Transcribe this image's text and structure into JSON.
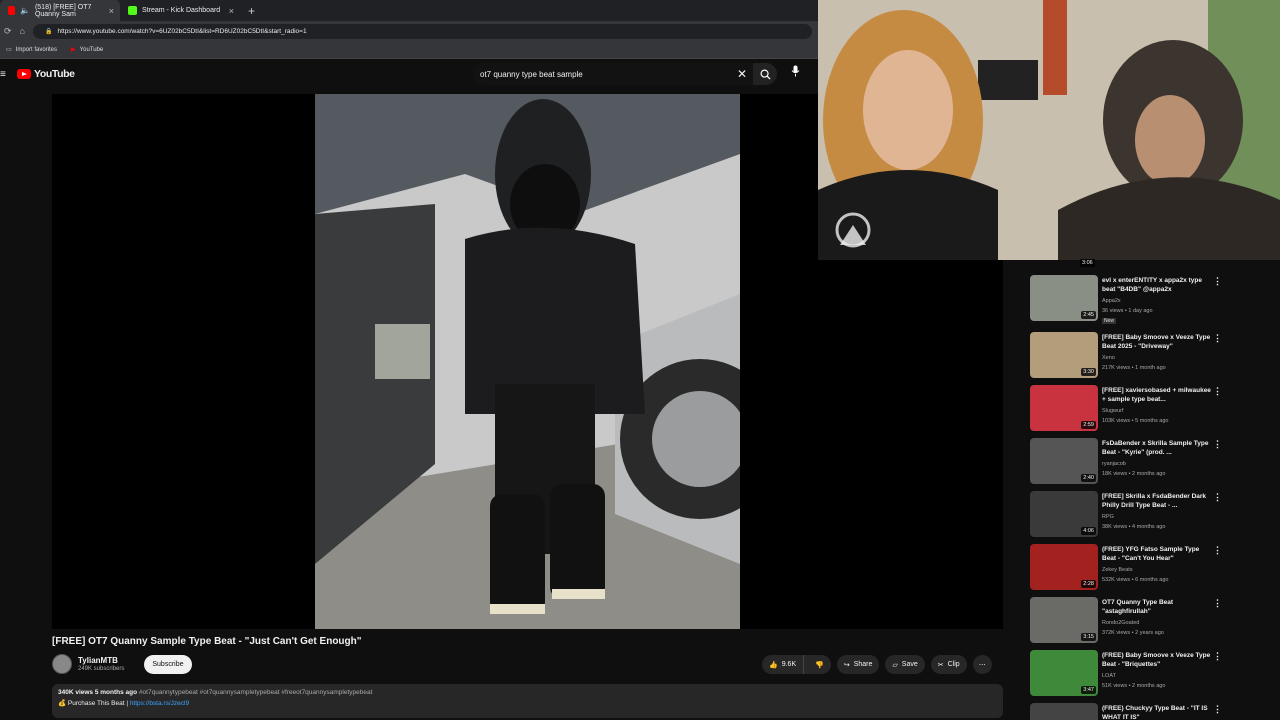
{
  "browser": {
    "tabs": [
      {
        "label": "(518) [FREE] OT7 Quanny Sam",
        "icon": "youtube-icon",
        "color": "#ff0000"
      },
      {
        "label": "Stream - Kick Dashboard",
        "icon": "kick-icon",
        "color": "#53fc18"
      }
    ],
    "new_tab": "+",
    "url": "https://www.youtube.com/watch?v=6UZ02bC5DtI&list=RD6UZ02bC5DtI&start_radio=1",
    "bookmarks": [
      {
        "label": "Import favorites",
        "icon": "folder-icon"
      },
      {
        "label": "YouTube",
        "icon": "youtube-icon"
      }
    ]
  },
  "youtube": {
    "logo": "YouTube",
    "search_value": "ot7 quanny type beat sample"
  },
  "video": {
    "title": "[FREE] OT7 Quanny Sample Type Beat - \"Just Can't Get Enough\"",
    "channel": "TylianMTB",
    "subscribers": "249K subscribers",
    "subscribe_label": "Subscribe",
    "likes": "9.6K",
    "share_label": "Share",
    "save_label": "Save",
    "clip_label": "Clip",
    "views_ago": "340K views  5 months ago",
    "hashtags": "#ot7quannytypebeat #ot7quannysampletypebeat #freeot7quannysampletypebeat",
    "purchase_text": "Purchase This Beat | ",
    "purchase_link": "https://bsta.rs/Jzecl9"
  },
  "sidebar": {
    "top_duration": "3:06",
    "items": [
      {
        "title": "evl x enterENTITY x appa2x type beat \"B4DB\" @appa2x",
        "channel": "Appa2x",
        "meta": "36 views • 1 day ago",
        "badge": "New",
        "duration": "2:45",
        "thumb_color": "#8a8f86"
      },
      {
        "title": "[FREE] Baby Smoove x Veeze Type Beat 2025 - \"Driveway\"",
        "channel": "Xeno",
        "meta": "217K views • 1 month ago",
        "duration": "3:30",
        "thumb_color": "#b49d7a"
      },
      {
        "title": "[FREE] xaviersobased + milwaukee + sample type beat...",
        "channel": "Slugwurf",
        "meta": "103K views • 5 months ago",
        "duration": "2:59",
        "thumb_color": "#c8333f"
      },
      {
        "title": "FsDaBender x Skrilla Sample Type Beat - \"Kyrie\" (prod. ...",
        "channel": "ryanjacob",
        "meta": "18K views • 2 months ago",
        "duration": "2:40",
        "thumb_color": "#555555"
      },
      {
        "title": "[FREE] Skrilla x FsdaBender Dark Philly Drill Type Beat - ...",
        "channel": "RPG",
        "meta": "38K views • 4 months ago",
        "duration": "4:06",
        "thumb_color": "#3a3a3a"
      },
      {
        "title": "(FREE) YFG Fatso Sample Type Beat - \"Can't You Hear\"",
        "channel": "Zekey Beats",
        "meta": "532K views • 6 months ago",
        "duration": "2:28",
        "thumb_color": "#a3221f"
      },
      {
        "title": "OT7 Quanny Type Beat \"astaghfirullah\"",
        "channel": "Rondo2Goated",
        "meta": "372K views • 2 years ago",
        "duration": "3:15",
        "thumb_color": "#6a6a66"
      },
      {
        "title": "(FREE) Baby Smoove x Veeze Type Beat - \"Briquettes\"",
        "channel": "LOAT",
        "meta": "51K views • 2 months ago",
        "duration": "3:47",
        "thumb_color": "#3e8a3a"
      },
      {
        "title": "(FREE) Chuckyy Type Beat - \"IT IS WHAT IT IS\"",
        "channel": "",
        "meta": "",
        "duration": "",
        "thumb_color": "#444444"
      }
    ]
  }
}
